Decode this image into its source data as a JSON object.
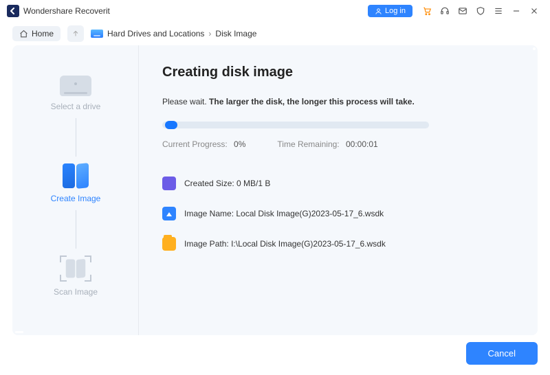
{
  "titlebar": {
    "app_name": "Wondershare Recoverit",
    "login_label": "Log in"
  },
  "toolbar": {
    "home_label": "Home",
    "breadcrumb": {
      "level1": "Hard Drives and Locations",
      "level2": "Disk Image"
    }
  },
  "sidebar": {
    "step1": "Select a drive",
    "step2": "Create Image",
    "step3": "Scan Image"
  },
  "main": {
    "heading": "Creating disk image",
    "subtitle_plain": "Please wait. ",
    "subtitle_bold": "The larger the disk, the longer this process will take.",
    "progress": {
      "label": "Current Progress:",
      "value": "0%",
      "time_label": "Time Remaining:",
      "time_value": "00:00:01"
    },
    "created_size": {
      "label": "Created Size:",
      "value": "0 MB/1 B"
    },
    "image_name": {
      "label": "Image Name:",
      "value": "Local Disk Image(G)2023-05-17_6.wsdk"
    },
    "image_path": {
      "label": "Image Path:",
      "value": "I:\\Local Disk Image(G)2023-05-17_6.wsdk"
    }
  },
  "footer": {
    "cancel_label": "Cancel"
  }
}
